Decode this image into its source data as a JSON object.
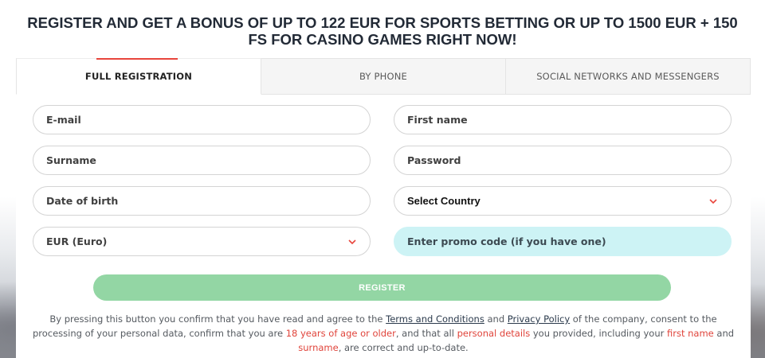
{
  "headline": "REGISTER AND GET A BONUS OF UP TO 122 EUR FOR SPORTS BETTING OR UP TO 1500 EUR + 150 FS FOR CASINO GAMES RIGHT NOW!",
  "tabs": [
    {
      "label": "FULL REGISTRATION",
      "active": true
    },
    {
      "label": "BY PHONE",
      "active": false
    },
    {
      "label": "SOCIAL NETWORKS AND MESSENGERS",
      "active": false
    }
  ],
  "form": {
    "email_placeholder": "E-mail",
    "first_name_placeholder": "First name",
    "surname_placeholder": "Surname",
    "password_placeholder": "Password",
    "dob_placeholder": "Date of birth",
    "country_selected": "Select Country",
    "currency_selected": "EUR (Euro)",
    "promo_placeholder": "Enter promo code (if you have one)",
    "chevron_icon": "chevron-down-icon"
  },
  "register_label": "REGISTER",
  "consent": {
    "t1": "By pressing this button you confirm that you have read and agree to the ",
    "terms_link": "Terms and Conditions",
    "t2": " and ",
    "privacy_link": "Privacy Policy",
    "t3": " of the company, consent to the processing of your personal data, confirm that you are ",
    "age": "18 years of age or older",
    "t4": ", and that all ",
    "personal_details": "personal details",
    "t5": " you provided, including your ",
    "first_name": "first name",
    "t6": " and ",
    "surname": "surname",
    "t7": ", are correct and up-to-date."
  },
  "colors": {
    "accent": "#e8453c",
    "register_button": "#93d6a4",
    "promo_field": "#cdf3f5",
    "headline_text": "#222a36"
  }
}
